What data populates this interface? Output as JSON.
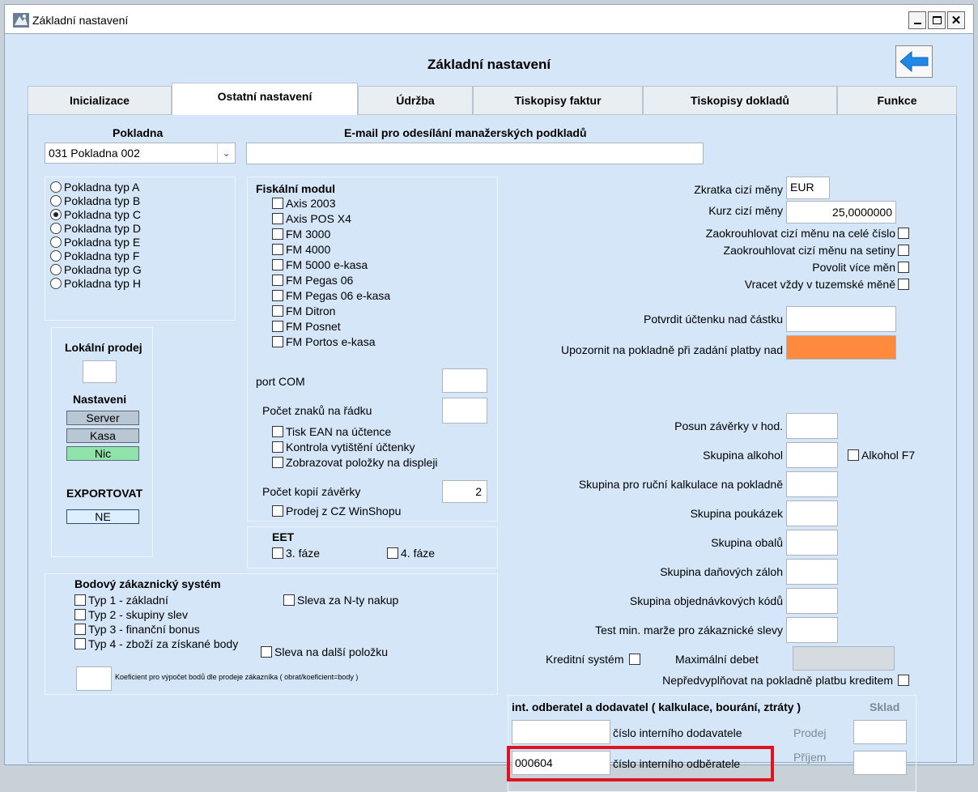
{
  "window": {
    "title": "Základní nastavení",
    "heading": "Základní nastavení"
  },
  "tabs": [
    {
      "label": "Inicializace"
    },
    {
      "label": "Ostatní nastavení"
    },
    {
      "label": "Údržba"
    },
    {
      "label": "Tiskopisy faktur"
    },
    {
      "label": "Tiskopisy dokladů"
    },
    {
      "label": "Funkce"
    }
  ],
  "active_tab": "Ostatní nastavení",
  "pokladna": {
    "label": "Pokladna",
    "value": "031 Pokladna 002"
  },
  "email": {
    "label": "E-mail pro odesílání manažerských podkladů",
    "value": ""
  },
  "pokladna_types": [
    {
      "label": "Pokladna typ A",
      "selected": false
    },
    {
      "label": "Pokladna typ B",
      "selected": false
    },
    {
      "label": "Pokladna typ C",
      "selected": true
    },
    {
      "label": "Pokladna typ D",
      "selected": false
    },
    {
      "label": "Pokladna typ E",
      "selected": false
    },
    {
      "label": "Pokladna typ F",
      "selected": false
    },
    {
      "label": "Pokladna typ G",
      "selected": false
    },
    {
      "label": "Pokladna typ H",
      "selected": false
    }
  ],
  "local_sale": {
    "title": "Lokální prodej",
    "value": "",
    "settings_label": "Nastaveni",
    "buttons": [
      {
        "label": "Server",
        "color": "#b9c6d4"
      },
      {
        "label": "Kasa",
        "color": "#b9c6d4"
      },
      {
        "label": "Nic",
        "color": "#8fe3a8"
      }
    ],
    "export_label": "EXPORTOVAT",
    "export_value": "NE",
    "export_color": "#dcefff"
  },
  "fiscal": {
    "title": "Fiskální modul",
    "items": [
      "Axis 2003",
      "Axis POS X4",
      "FM 3000",
      "FM 4000",
      "FM 5000  e-kasa",
      "FM Pegas 06",
      "FM Pegas 06  e-kasa",
      "FM Ditron",
      "FM Posnet",
      "FM Portos  e-kasa"
    ],
    "port_label": "port COM",
    "port_value": "",
    "chars_label": "Počet znaků na řádku",
    "chars_value": "",
    "options": [
      "Tisk EAN na účtence",
      "Kontrola vytištění účtenky",
      "Zobrazovat položky na displeji"
    ],
    "copies_label": "Počet kopií závěrky",
    "copies_value": "2",
    "winshop_label": "Prodej z CZ WinShopu"
  },
  "eet": {
    "title": "EET",
    "phase3": "3. fáze",
    "phase4": "4. fáze"
  },
  "bonus": {
    "title": "Bodový zákaznický systém",
    "left": [
      "Typ 1 - základní",
      "Typ 2 - skupiny slev",
      "Typ 3 - finanční bonus",
      "Typ 4 - zboží za získané body"
    ],
    "right1": "Sleva za N-ty nakup",
    "right2": "Sleva na další položku",
    "coef_label": "Koeficient pro výpočet bodů dle prodeje zákazníka ( obrat/koeficient=body )",
    "coef_value": ""
  },
  "currency": {
    "code_label": "Zkratka cizí měny",
    "code_value": "EUR",
    "rate_label": "Kurz cizí měny",
    "rate_value": "25,0000000",
    "checks": [
      "Zaokrouhlovat cizí měnu na celé číslo",
      "Zaokrouhlovat cizí měnu na setiny",
      "Povolit více měn",
      "Vracet vždy v tuzemské měně"
    ],
    "confirm_label": "Potvrdit účtenku nad částku",
    "confirm_value": "",
    "warn_label": "Upozornit na pokladně při zadání platby nad",
    "warn_value": "",
    "warn_color": "#ff8a3d"
  },
  "groups": {
    "posun_label": "Posun závěrky v hod.",
    "alkohol_label": "Skupina alkohol",
    "alkohol_f7_label": "Alkohol F7",
    "rucni_label": "Skupina pro ruční kalkulace na pokladně",
    "poukazek_label": "Skupina poukázek",
    "obalu_label": "Skupina obalů",
    "zaloh_label": "Skupina daňových záloh",
    "objednavkovych_label": "Skupina objednávkových kódů",
    "marze_label": "Test min. marže  pro zákaznické slevy",
    "kredit_label": "Kreditní systém",
    "max_debet_label": "Maximální debet",
    "nepredvyplnovat_label": "Nepředvyplňovat na pokladně platbu kreditem"
  },
  "internal": {
    "title": "int. odberatel a dodavatel  ( kalkulace, bourání, ztráty )",
    "sklad_label": "Sklad",
    "dodavatel_value": "",
    "dodavatel_label": "číslo interního dodavatele",
    "odberatel_value": "000604",
    "odberatel_label": "číslo interního odběratele",
    "prodej_label": "Prodej",
    "prijem_label": "Příjem",
    "highlight_color": "#e0141e"
  }
}
